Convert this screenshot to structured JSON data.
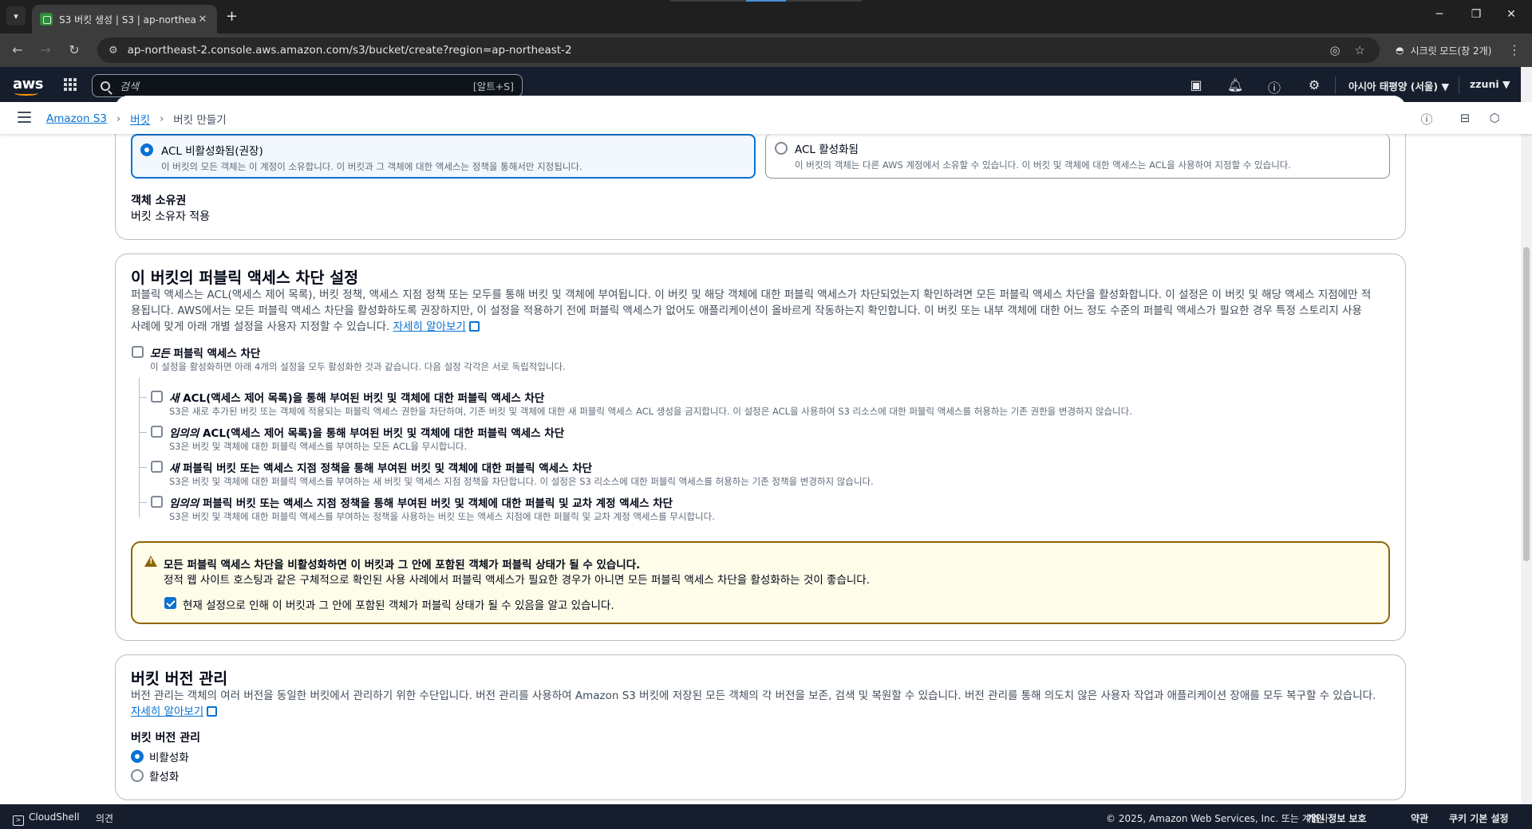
{
  "browser": {
    "tab_title": "S3 버킷 생성 | S3 | ap-northeast-2",
    "url": "ap-northeast-2.console.aws.amazon.com/s3/bucket/create?region=ap-northeast-2",
    "incognito_label": "시크릿 모드(창 2개)"
  },
  "aws_nav": {
    "logo": "aws",
    "search_placeholder": "검색",
    "search_shortcut": "[알트+S]",
    "region": "아시아 태평양 (서울) ▼",
    "user": "zzuni ▼"
  },
  "breadcrumb": {
    "items": [
      "Amazon S3",
      "버킷"
    ],
    "current": "버킷 만들기"
  },
  "ownership": {
    "acl_disabled": {
      "title": "ACL 비활성화됨(권장)",
      "desc": "이 버킷의 모든 객체는 이 계정이 소유합니다. 이 버킷과 그 객체에 대한 액세스는 정책을 통해서만 지정됩니다."
    },
    "acl_enabled": {
      "title": "ACL 활성화됨",
      "desc": "이 버킷의 객체는 다른 AWS 계정에서 소유할 수 있습니다. 이 버킷 및 객체에 대한 액세스는 ACL을 사용하여 지정할 수 있습니다."
    },
    "object_ownership_label": "객체 소유권",
    "object_ownership_value": "버킷 소유자 적용"
  },
  "public_access": {
    "heading": "이 버킷의 퍼블릭 액세스 차단 설정",
    "desc_line1": "퍼블릭 액세스는 ACL(액세스 제어 목록), 버킷 정책, 액세스 지점 정책 또는 모두를 통해 버킷 및 객체에 부여됩니다. 이 버킷 및 해당 객체에 대한 퍼블릭 액세스가 차단되었는지 확인하려면 모든 퍼블릭 액세스 차단을 활성화합니다. 이 설정은 이 버킷 및 해당 액세스 지점에만 적",
    "desc_line2": "용됩니다. AWS에서는 모든 퍼블릭 액세스 차단을 활성화하도록 권장하지만, 이 설정을 적용하기 전에 퍼블릭 액세스가 없어도 애플리케이션이 올바르게 작동하는지 확인합니다. 이 버킷 또는 내부 객체에 대한 어느 정도 수준의 퍼블릭 액세스가 필요한 경우 특정 스토리지 사용",
    "desc_line3": "사례에 맞게 아래 개별 설정을 사용자 지정할 수 있습니다.",
    "learn_more": "자세히 알아보기",
    "block_all_em": "모든",
    "block_all_rest": " 퍼블릭 액세스 차단",
    "block_all_desc": "이 설정을 활성화하면 아래 4개의 설정을 모두 활성화한 것과 같습니다. 다음 설정 각각은 서로 독립적입니다.",
    "options": [
      {
        "em": "새",
        "rest": " ACL(액세스 제어 목록)을 통해 부여된 버킷 및 객체에 대한 퍼블릭 액세스 차단",
        "desc": "S3은 새로 추가된 버킷 또는 객체에 적용되는 퍼블릭 액세스 권한을 차단하며, 기존 버킷 및 객체에 대한 새 퍼블릭 액세스 ACL 생성을 금지합니다. 이 설정은 ACL을 사용하여 S3 리소스에 대한 퍼블릭 액세스를 허용하는 기존 권한을 변경하지 않습니다."
      },
      {
        "em": "임의의",
        "rest": " ACL(액세스 제어 목록)을 통해 부여된 버킷 및 객체에 대한 퍼블릭 액세스 차단",
        "desc": "S3은 버킷 및 객체에 대한 퍼블릭 액세스를 부여하는 모든 ACL을 무시합니다."
      },
      {
        "em": "새",
        "rest": " 퍼블릭 버킷 또는 액세스 지점 정책을 통해 부여된 버킷 및 객체에 대한 퍼블릭 액세스 차단",
        "desc": "S3은 버킷 및 객체에 대한 퍼블릭 액세스를 부여하는 새 버킷 및 액세스 지점 정책을 차단합니다. 이 설정은 S3 리소스에 대한 퍼블릭 액세스를 허용하는 기존 정책을 변경하지 않습니다."
      },
      {
        "em": "임의의",
        "rest": " 퍼블릭 버킷 또는 액세스 지점 정책을 통해 부여된 버킷 및 객체에 대한 퍼블릭 및 교차 계정 액세스 차단",
        "desc": "S3은 버킷 및 객체에 대한 퍼블릭 액세스를 부여하는 정책을 사용하는 버킷 또는 액세스 지점에 대한 퍼블릭 및 교차 계정 액세스를 무시합니다."
      }
    ],
    "warning_title": "모든 퍼블릭 액세스 차단을 비활성화하면 이 버킷과 그 안에 포함된 객체가 퍼블릭 상태가 될 수 있습니다.",
    "warning_desc": "정적 웹 사이트 호스팅과 같은 구체적으로 확인된 사용 사례에서 퍼블릭 액세스가 필요한 경우가 아니면 모든 퍼블릭 액세스 차단을 활성화하는 것이 좋습니다.",
    "ack_label": "현재 설정으로 인해 이 버킷과 그 안에 포함된 객체가 퍼블릭 상태가 될 수 있음을 알고 있습니다."
  },
  "versioning": {
    "heading": "버킷 버전 관리",
    "desc": "버전 관리는 객체의 여러 버전을 동일한 버킷에서 관리하기 위한 수단입니다. 버전 관리를 사용하여 Amazon S3 버킷에 저장된 모든 객체의 각 버전을 보존, 검색 및 복원할 수 있습니다. 버전 관리를 통해 의도치 않은 사용자 작업과 애플리케이션 장애를 모두 복구할 수 있습니다.",
    "learn_more": "자세히 알아보기",
    "field_label": "버킷 버전 관리",
    "option_disable": "비활성화",
    "option_enable": "활성화"
  },
  "footer": {
    "cloudshell": "CloudShell",
    "feedback": "의견",
    "copyright": "© 2025, Amazon Web Services, Inc. 또는 계열사.",
    "privacy": "개인 정보 보호",
    "terms": "약관",
    "cookies": "쿠키 기본 설정"
  },
  "colors": {
    "accent": "#0972d3",
    "nav_bg": "#161e2d",
    "warning": "#8d6605"
  }
}
